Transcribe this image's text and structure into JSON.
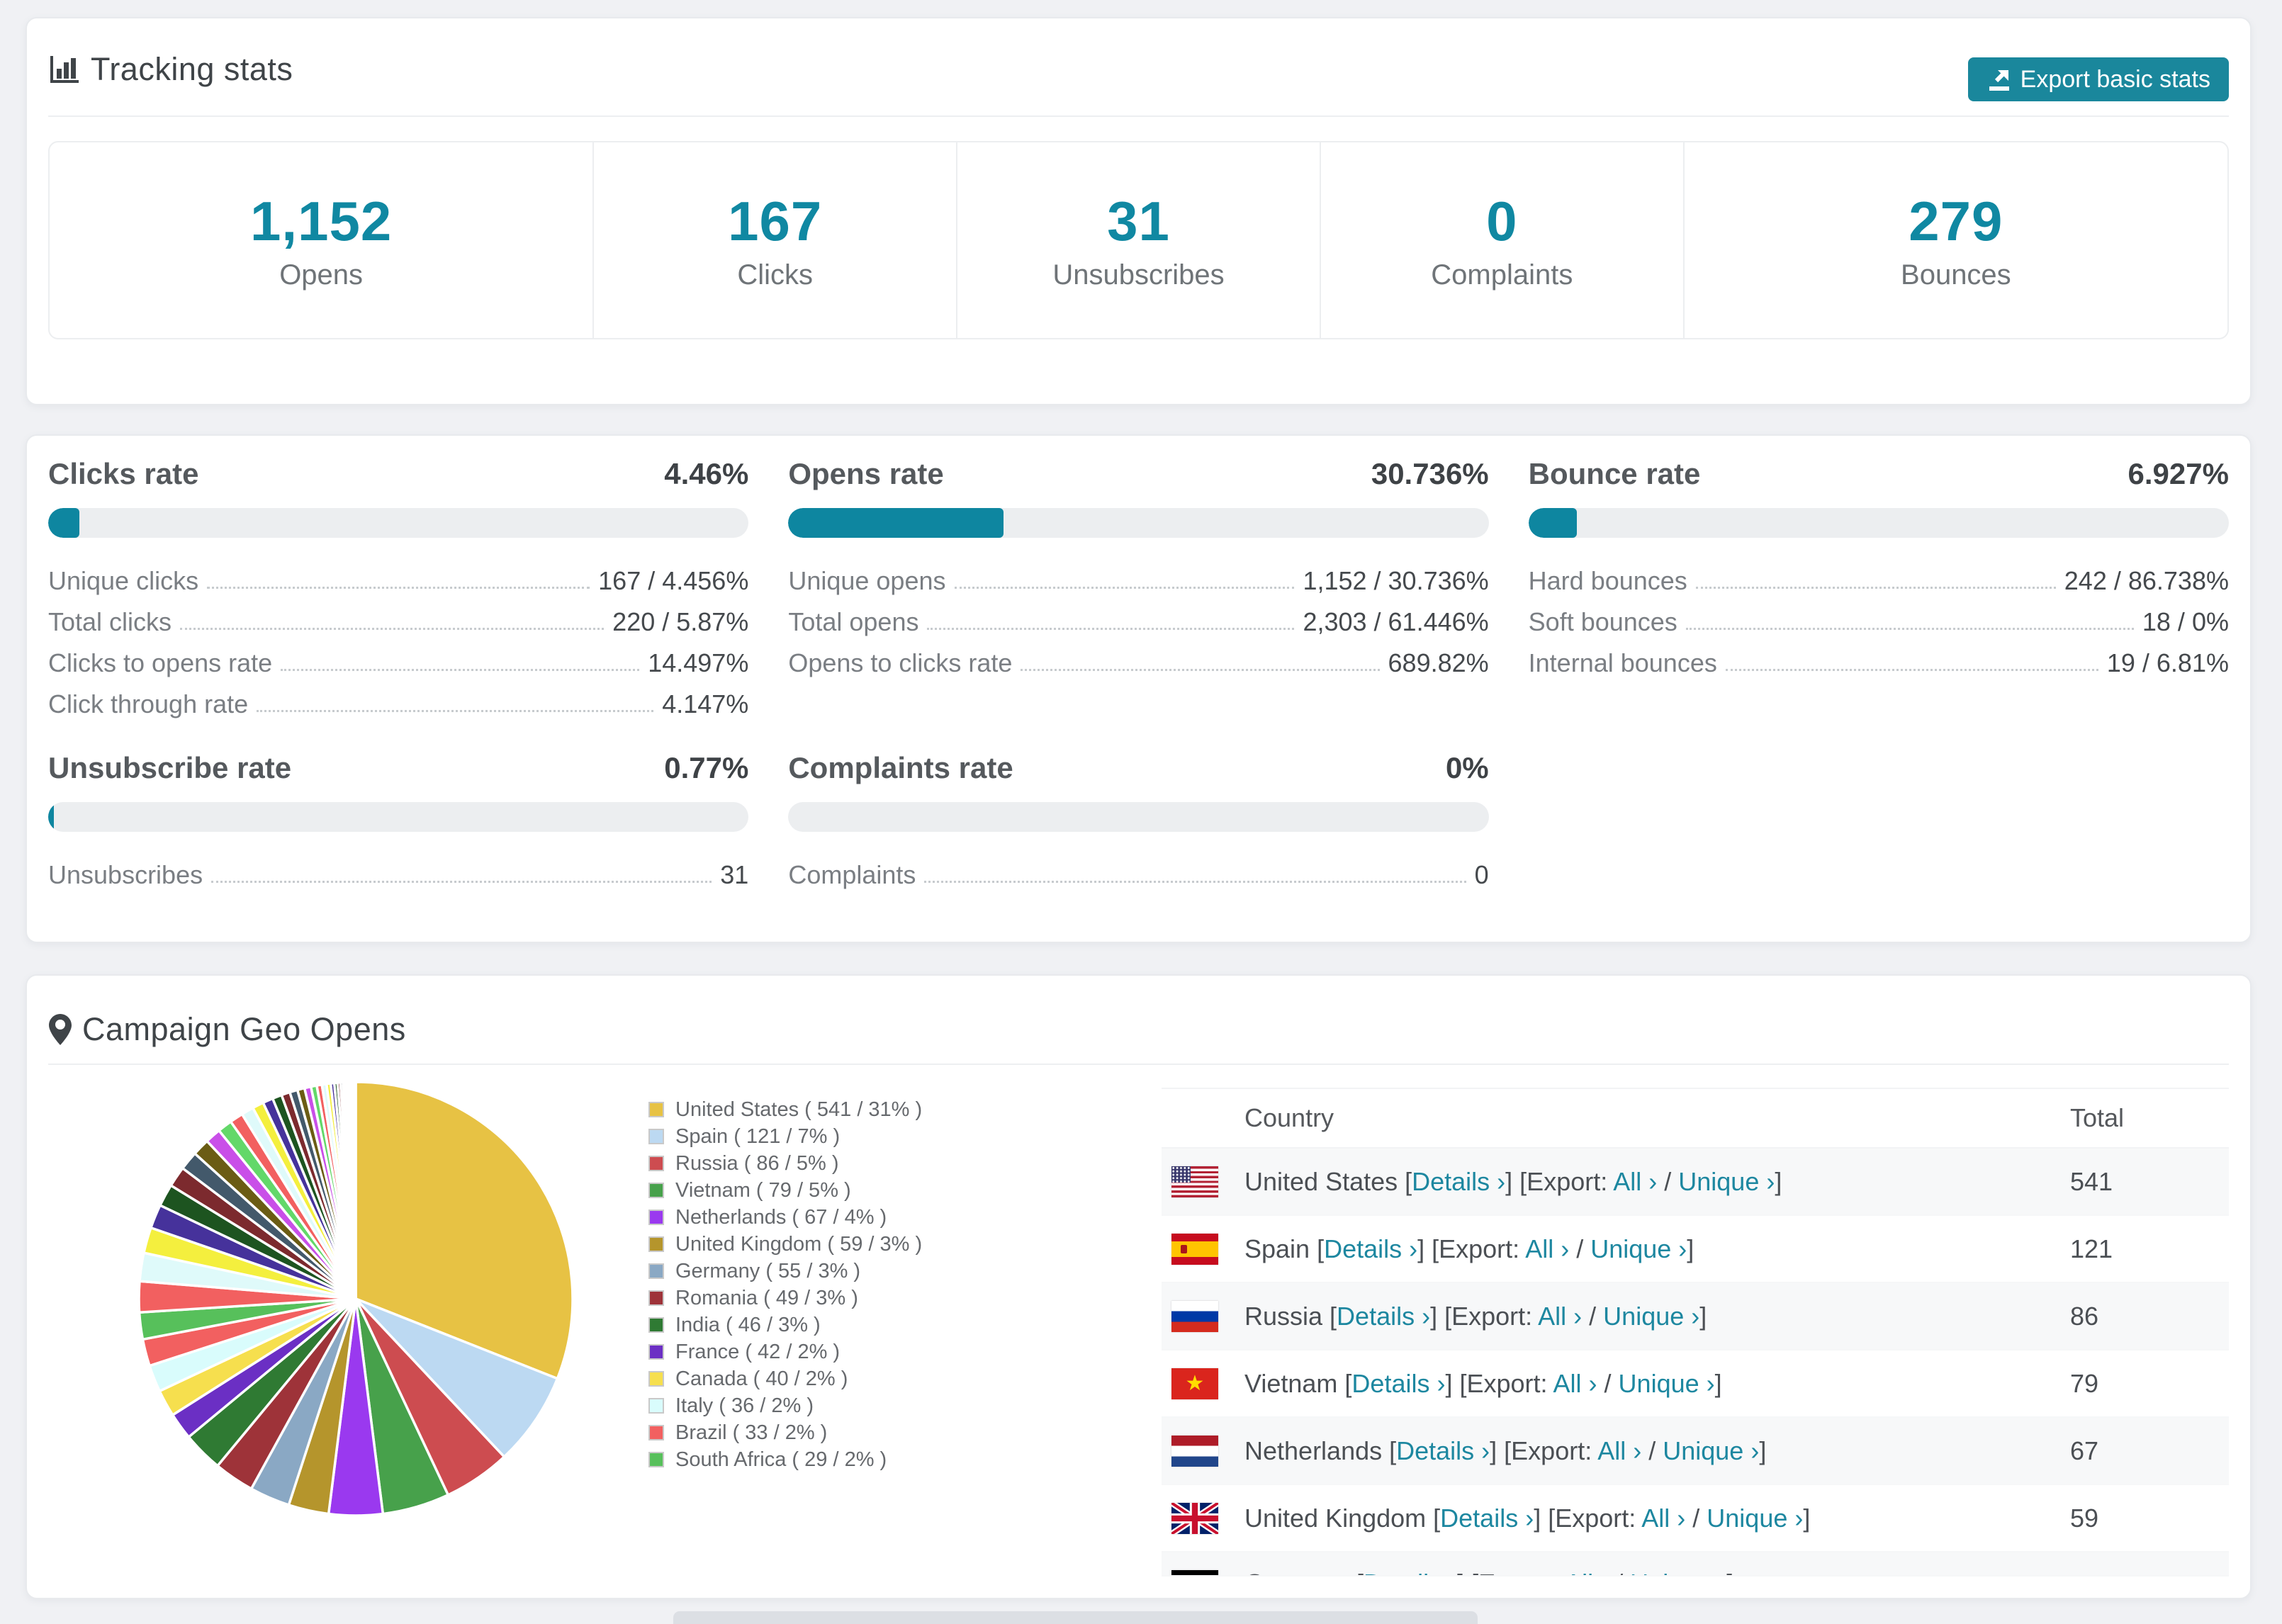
{
  "tracking": {
    "title": "Tracking stats",
    "export_button": "Export basic stats",
    "stats": [
      {
        "value": "1,152",
        "label": "Opens"
      },
      {
        "value": "167",
        "label": "Clicks"
      },
      {
        "value": "31",
        "label": "Unsubscribes"
      },
      {
        "value": "0",
        "label": "Complaints"
      },
      {
        "value": "279",
        "label": "Bounces"
      }
    ]
  },
  "rates": {
    "sections": [
      {
        "title": "Clicks rate",
        "pct": "4.46%",
        "bar": 4.46,
        "rows": [
          {
            "label": "Unique clicks",
            "value": "167 / 4.456%"
          },
          {
            "label": "Total clicks",
            "value": "220 / 5.87%"
          },
          {
            "label": "Clicks to opens rate",
            "value": "14.497%"
          },
          {
            "label": "Click through rate",
            "value": "4.147%"
          }
        ]
      },
      {
        "title": "Opens rate",
        "pct": "30.736%",
        "bar": 30.736,
        "rows": [
          {
            "label": "Unique opens",
            "value": "1,152 / 30.736%"
          },
          {
            "label": "Total opens",
            "value": "2,303 / 61.446%"
          },
          {
            "label": "Opens to clicks rate",
            "value": "689.82%"
          }
        ]
      },
      {
        "title": "Bounce rate",
        "pct": "6.927%",
        "bar": 6.927,
        "rows": [
          {
            "label": "Hard bounces",
            "value": "242 / 86.738%"
          },
          {
            "label": "Soft bounces",
            "value": "18 / 0%"
          },
          {
            "label": "Internal bounces",
            "value": "19 / 6.81%"
          }
        ]
      },
      {
        "title": "Unsubscribe rate",
        "pct": "0.77%",
        "bar": 0.77,
        "rows": [
          {
            "label": "Unsubscribes",
            "value": "31"
          }
        ]
      },
      {
        "title": "Complaints rate",
        "pct": "0%",
        "bar": 0,
        "rows": [
          {
            "label": "Complaints",
            "value": "0"
          }
        ]
      }
    ]
  },
  "geo": {
    "title": "Campaign Geo Opens",
    "table_headers": {
      "country": "Country",
      "total": "Total"
    },
    "links": {
      "details": "Details ›",
      "export_label": "Export:",
      "all": "All ›",
      "unique": "Unique ›"
    },
    "countries": [
      {
        "flag": "us",
        "name": "United States",
        "total": "541",
        "pct": 31,
        "color": "#e7c244",
        "legend_label": "United States ( 541 / 31% )",
        "in_table": true
      },
      {
        "flag": "es",
        "name": "Spain",
        "total": "121",
        "pct": 7,
        "color": "#bcd9f2",
        "legend_label": "Spain ( 121 / 7% )",
        "in_table": true
      },
      {
        "flag": "ru",
        "name": "Russia",
        "total": "86",
        "pct": 5,
        "color": "#cd4c50",
        "legend_label": "Russia ( 86 / 5% )",
        "in_table": true
      },
      {
        "flag": "vn",
        "name": "Vietnam",
        "total": "79",
        "pct": 5,
        "color": "#47a14b",
        "legend_label": "Vietnam ( 79 / 5% )",
        "in_table": true
      },
      {
        "flag": "nl",
        "name": "Netherlands",
        "total": "67",
        "pct": 4,
        "color": "#9a39ef",
        "legend_label": "Netherlands ( 67 / 4% )",
        "in_table": true
      },
      {
        "flag": "gb",
        "name": "United Kingdom",
        "total": "59",
        "pct": 3,
        "color": "#b5952c",
        "legend_label": "United Kingdom ( 59 / 3% )",
        "in_table": true
      },
      {
        "flag": "de",
        "name": "Germany",
        "total": "55",
        "pct": 3,
        "color": "#8aa8c4",
        "legend_label": "Germany ( 55 / 3% )",
        "in_table": false
      },
      {
        "flag": "ro",
        "name": "Romania",
        "total": "49",
        "pct": 3,
        "color": "#9e3339",
        "legend_label": "Romania ( 49 / 3% )",
        "in_table": false
      },
      {
        "flag": "in",
        "name": "India",
        "total": "46",
        "pct": 3,
        "color": "#2f7a33",
        "legend_label": "India ( 46 / 3% )",
        "in_table": false
      },
      {
        "flag": "fr",
        "name": "France",
        "total": "42",
        "pct": 2,
        "color": "#6b2fc4",
        "legend_label": "France ( 42 / 2% )",
        "in_table": false
      },
      {
        "flag": "ca",
        "name": "Canada",
        "total": "40",
        "pct": 2,
        "color": "#f6df4e",
        "legend_label": "Canada ( 40 / 2% )",
        "in_table": false
      },
      {
        "flag": "it",
        "name": "Italy",
        "total": "36",
        "pct": 2,
        "color": "#d9fcfc",
        "legend_label": "Italy ( 36 / 2% )",
        "in_table": false
      },
      {
        "flag": "br",
        "name": "Brazil",
        "total": "33",
        "pct": 2,
        "color": "#f26060",
        "legend_label": "Brazil ( 33 / 2% )",
        "in_table": false
      },
      {
        "flag": "za",
        "name": "South Africa",
        "total": "29",
        "pct": 2,
        "color": "#57c05b",
        "legend_label": "South Africa ( 29 / 2% )",
        "in_table": false
      }
    ],
    "partial_row": {
      "flag": "de"
    },
    "others_segments": {
      "values": [
        1.8,
        1.65,
        1.5,
        1.4,
        1.3,
        1.2,
        1.1,
        1.0,
        0.92,
        0.85,
        0.78,
        0.72,
        0.66,
        0.6,
        0.55,
        0.5,
        0.46,
        0.42,
        0.38,
        0.34,
        0.3,
        0.27,
        0.24,
        0.21,
        0.19,
        0.17,
        0.15,
        0.13,
        0.11,
        0.1,
        0.09,
        0.08,
        0.07,
        0.06,
        0.05,
        0.04
      ],
      "colors": [
        "#f26060",
        "#dffafa",
        "#f4ef3e",
        "#46329b",
        "#1d5420",
        "#7c2a2e",
        "#43596b",
        "#6b5c14",
        "#c94fe8",
        "#63d869"
      ]
    }
  }
}
